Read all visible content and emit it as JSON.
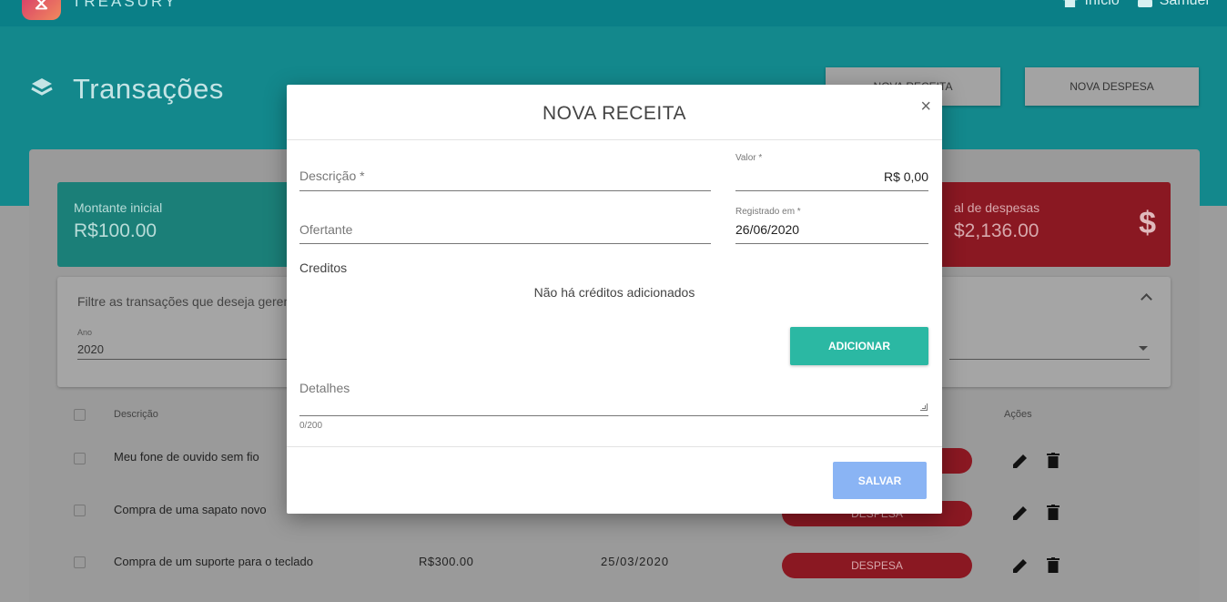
{
  "app": {
    "brand": "TREASURY"
  },
  "topnav": {
    "home_label": "Início",
    "user_label": "Samuel"
  },
  "header": {
    "title": "Transações",
    "btn_new_income": "NOVA RECEITA",
    "btn_new_expense": "NOVA DESPESA"
  },
  "cards": {
    "initial": {
      "label": "Montante inicial",
      "value": "R$100.00"
    },
    "expenses": {
      "label": "al de despesas",
      "value": "$2,136.00",
      "icon": "$"
    }
  },
  "filter": {
    "text": "Filtre as transações que deseja gerenc",
    "year_label": "Ano",
    "year_value": "2020"
  },
  "table": {
    "headers": {
      "description": "Descrição",
      "actions": "Ações"
    },
    "rows": [
      {
        "description": "Meu fone de ouvido sem fio",
        "value": "",
        "date": "",
        "type": ""
      },
      {
        "description": "Compra de uma sapato novo",
        "value": "",
        "date": "",
        "type": "DESPESA"
      },
      {
        "description": "Compra de um suporte para o teclado",
        "value": "R$300.00",
        "date": "25/03/2020",
        "type": "DESPESA"
      }
    ]
  },
  "modal": {
    "title": "NOVA RECEITA",
    "close": "×",
    "descricao_label": "Descrição *",
    "valor_label": "Valor *",
    "valor_value": "R$ 0,00",
    "ofertante_label": "Ofertante",
    "registrado_label": "Registrado em *",
    "registrado_value": "26/06/2020",
    "creditos_label": "Creditos",
    "empty_credits": "Não há créditos adicionados",
    "add_button": "ADICIONAR",
    "detalhes_label": "Detalhes",
    "counter": "0/200",
    "save_button": "SALVAR"
  },
  "colors": {
    "accent": "#2bb8a3",
    "save": "#8ab4f4",
    "expense": "#8a1822"
  }
}
